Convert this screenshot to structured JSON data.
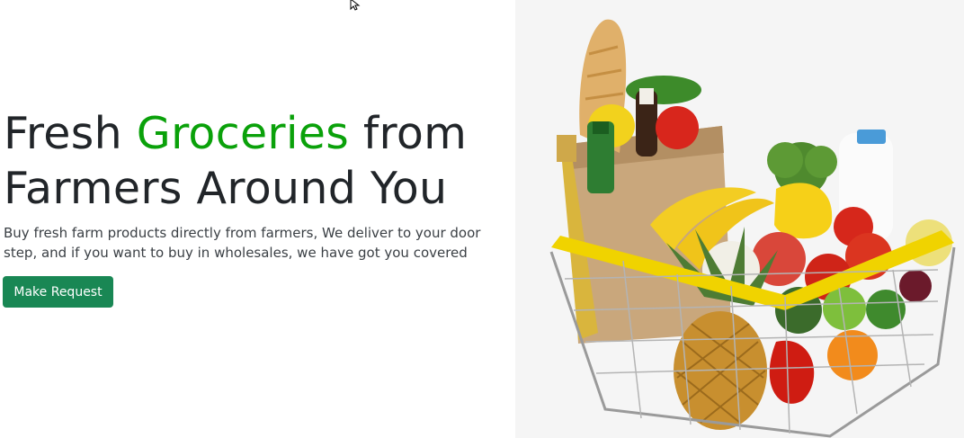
{
  "hero": {
    "title_part1": "Fresh ",
    "title_accent": "Groceries",
    "title_part2": " from Farmers Around You",
    "description": "Buy fresh farm products directly from farmers, We deliver to your door step, and if you want to buy in wholesales, we have got you covered",
    "cta_label": "Make Request"
  },
  "image": {
    "icon": "grocery-basket-icon"
  },
  "colors": {
    "accent": "#0aa10a",
    "button": "#198754",
    "text": "#212529",
    "image_panel": "#f5f5f5"
  }
}
